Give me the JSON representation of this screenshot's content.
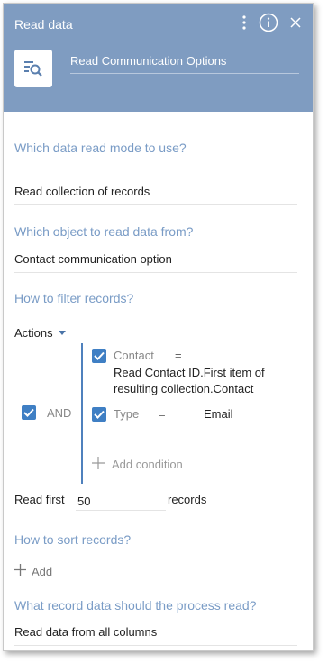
{
  "header": {
    "title": "Read data",
    "element_name": "Read Communication Options",
    "icons": [
      "menu-dots-icon",
      "info-icon",
      "close-icon",
      "read-data-icon"
    ],
    "background_color": "#7f9cc1"
  },
  "read_mode": {
    "question": "Which data read mode to use?",
    "value": "Read collection of records"
  },
  "object": {
    "question": "Which object to read data from?",
    "value": "Contact communication option"
  },
  "filter": {
    "question": "How to filter records?",
    "actions_label": "Actions",
    "group_label": "AND",
    "conditions": [
      {
        "column": "Contact",
        "operator": "=",
        "value": "Read Contact ID.First item of resulting collection.Contact",
        "checked": true
      },
      {
        "column": "Type",
        "operator": "=",
        "value": "Email",
        "checked": true
      }
    ],
    "add_condition_label": "Add condition"
  },
  "read_first": {
    "label": "Read first",
    "value": "50",
    "suffix": "records"
  },
  "sort": {
    "question": "How to sort records?",
    "add_label": "Add"
  },
  "columns": {
    "question": "What record data should the process read?",
    "value": "Read data from all columns"
  },
  "accent_color": "#7a9cc6",
  "checkbox_color": "#3f7fc4"
}
